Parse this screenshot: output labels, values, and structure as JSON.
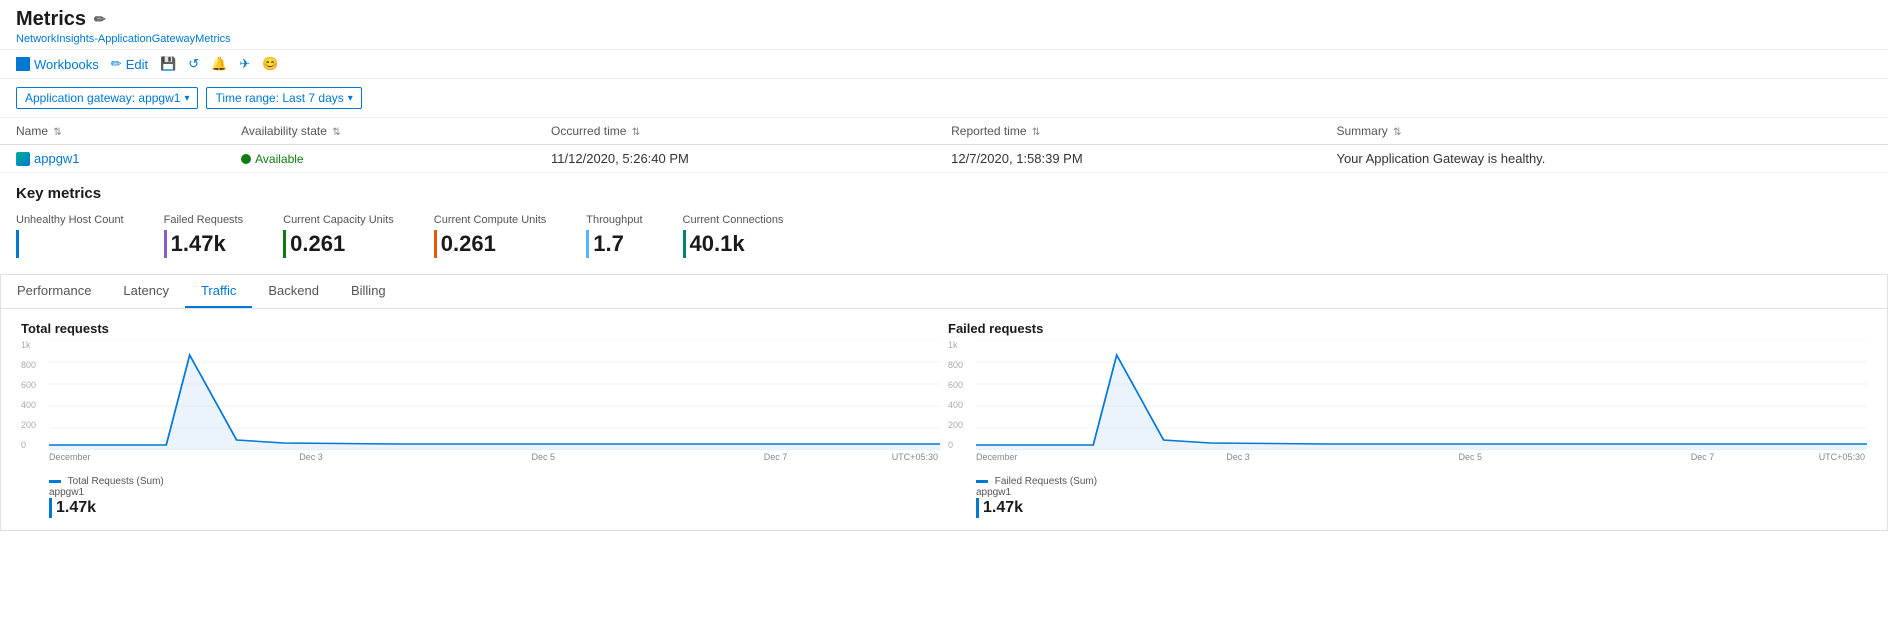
{
  "page": {
    "title": "Metrics",
    "breadcrumb": "NetworkInsights-ApplicationGatewayMetrics"
  },
  "toolbar": {
    "workbooks_label": "Workbooks",
    "edit_label": "Edit",
    "save_icon": "💾",
    "refresh_icon": "↺",
    "alert_icon": "🔔",
    "share_icon": "✈",
    "feedback_icon": "😊"
  },
  "filters": {
    "gateway_label": "Application gateway: appgw1",
    "time_range_label": "Time range: Last 7 days"
  },
  "health_table": {
    "columns": [
      "Name",
      "Availability state",
      "Occurred time",
      "Reported time",
      "Summary"
    ],
    "rows": [
      {
        "name": "appgw1",
        "availability": "Available",
        "occurred": "11/12/2020, 5:26:40 PM",
        "reported": "12/7/2020, 1:58:39 PM",
        "summary": "Your Application Gateway is healthy."
      }
    ]
  },
  "key_metrics": {
    "title": "Key metrics",
    "items": [
      {
        "label": "Unhealthy Host Count",
        "value": "",
        "bar_class": "bar-blue"
      },
      {
        "label": "Failed Requests",
        "value": "1.47k",
        "bar_class": "bar-purple"
      },
      {
        "label": "Current Capacity Units",
        "value": "0.261",
        "bar_class": "bar-green"
      },
      {
        "label": "Current Compute Units",
        "value": "0.261",
        "bar_class": "bar-orange"
      },
      {
        "label": "Throughput",
        "value": "1.7",
        "bar_class": "bar-lblue"
      },
      {
        "label": "Current Connections",
        "value": "40.1k",
        "bar_class": "bar-teal"
      }
    ]
  },
  "tabs": [
    {
      "label": "Performance",
      "active": false
    },
    {
      "label": "Latency",
      "active": false
    },
    {
      "label": "Traffic",
      "active": true
    },
    {
      "label": "Backend",
      "active": false
    },
    {
      "label": "Billing",
      "active": false
    }
  ],
  "charts": [
    {
      "title": "Total requests",
      "legend_label": "Total Requests (Sum)",
      "legend_sub": "appgw1",
      "legend_value": "1.47k",
      "y_labels": [
        "1k",
        "800",
        "600",
        "400",
        "200",
        "0"
      ],
      "x_labels": [
        "December",
        "",
        "Dec 3",
        "",
        "Dec 5",
        "",
        "Dec 7",
        "UTC+05:30"
      ],
      "color": "#0078d4"
    },
    {
      "title": "Failed requests",
      "legend_label": "Failed Requests (Sum)",
      "legend_sub": "appgw1",
      "legend_value": "1.47k",
      "y_labels": [
        "1k",
        "800",
        "600",
        "400",
        "200",
        "0"
      ],
      "x_labels": [
        "December",
        "",
        "Dec 3",
        "",
        "Dec 5",
        "",
        "Dec 7",
        "UTC+05:30"
      ],
      "color": "#0078d4"
    }
  ]
}
